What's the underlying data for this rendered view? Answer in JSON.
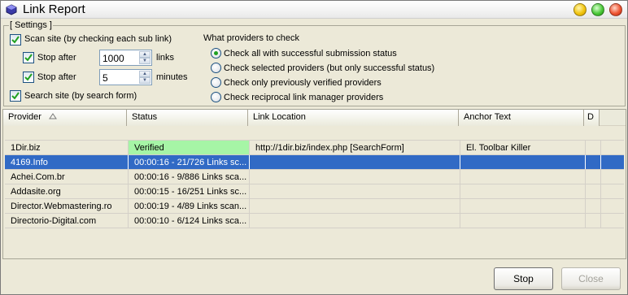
{
  "window": {
    "title": "Link Report"
  },
  "settings": {
    "legend": "[ Settings ]",
    "scan_site": {
      "label": "Scan site (by checking each sub link)",
      "checked": true
    },
    "stop_after_links": {
      "label": "Stop after",
      "value": "1000",
      "unit": "links",
      "checked": true
    },
    "stop_after_minutes": {
      "label": "Stop after",
      "value": "5",
      "unit": "minutes",
      "checked": true
    },
    "search_site": {
      "label": "Search site (by search form)",
      "checked": true
    },
    "providers_heading": "What providers to check",
    "provider_options": [
      {
        "label": "Check all with successful submission status",
        "selected": true
      },
      {
        "label": "Check selected providers (but only successful status)",
        "selected": false
      },
      {
        "label": "Check only previously verified providers",
        "selected": false
      },
      {
        "label": "Check reciprocal link manager providers",
        "selected": false
      }
    ]
  },
  "grid": {
    "columns": [
      "Provider",
      "Status",
      "Link Location",
      "Anchor Text",
      "D"
    ],
    "sort_icon": "sort-ascending-icon",
    "rows": [
      {
        "provider": "1Dir.biz",
        "status": "Verified",
        "link": "http://1dir.biz/index.php [SearchForm]",
        "anchor": "El. Toolbar Killer",
        "d": ""
      },
      {
        "provider": "4169.Info",
        "status": "00:00:16 - 21/726 Links sc...",
        "link": "",
        "anchor": "",
        "d": ""
      },
      {
        "provider": "Achei.Com.br",
        "status": "00:00:16 - 9/886 Links sca...",
        "link": "",
        "anchor": "",
        "d": ""
      },
      {
        "provider": "Addasite.org",
        "status": "00:00:15 - 16/251 Links sc...",
        "link": "",
        "anchor": "",
        "d": ""
      },
      {
        "provider": "Director.Webmastering.ro",
        "status": "00:00:19 - 4/89 Links scan...",
        "link": "",
        "anchor": "",
        "d": ""
      },
      {
        "provider": "Directorio-Digital.com",
        "status": "00:00:10 - 6/124 Links sca...",
        "link": "",
        "anchor": "",
        "d": ""
      }
    ]
  },
  "buttons": {
    "stop": "Stop",
    "close": "Close"
  },
  "colors": {
    "selection": "#316ac5",
    "verified": "#a6f5a6",
    "radio_dot": "#21a121",
    "window_bg": "#ece9d8"
  }
}
